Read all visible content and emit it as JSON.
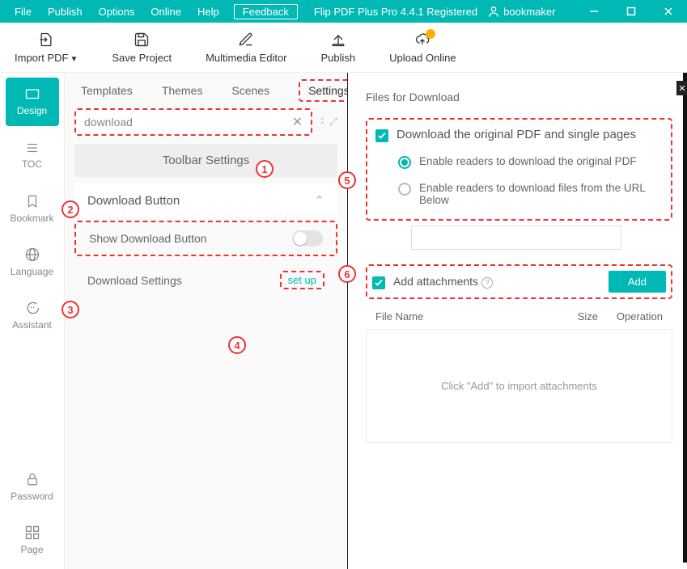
{
  "titlebar": {
    "menus": [
      "File",
      "Publish",
      "Options",
      "Online",
      "Help"
    ],
    "feedback": "Feedback",
    "app_title": "Flip PDF Plus Pro 4.4.1 Registered",
    "username": "bookmaker"
  },
  "toolbar": {
    "import": "Import PDF",
    "save": "Save Project",
    "multimedia": "Multimedia Editor",
    "publish": "Publish",
    "upload": "Upload Online"
  },
  "rail": {
    "design": "Design",
    "toc": "TOC",
    "bookmark": "Bookmark",
    "language": "Language",
    "assistant": "Assistant",
    "password": "Password",
    "page": "Page"
  },
  "tabs": {
    "templates": "Templates",
    "themes": "Themes",
    "scenes": "Scenes",
    "settings": "Settings"
  },
  "search": {
    "value": "download"
  },
  "sections": {
    "toolbar_settings": "Toolbar Settings",
    "download_button": "Download Button",
    "show_download": "Show Download Button",
    "download_settings": "Download Settings",
    "setup": "set up"
  },
  "right": {
    "title": "Files for Download",
    "check_download": "Download the original PDF and single pages",
    "radio1": "Enable readers to download the original PDF",
    "radio2": "Enable readers to download files from the URL Below",
    "add_attachments": "Add attachments",
    "add_btn": "Add",
    "col_name": "File Name",
    "col_size": "Size",
    "col_op": "Operation",
    "empty": "Click \"Add\" to import attachments"
  },
  "annotations": {
    "a1": "1",
    "a2": "2",
    "a3": "3",
    "a4": "4",
    "a5": "5",
    "a6": "6"
  }
}
